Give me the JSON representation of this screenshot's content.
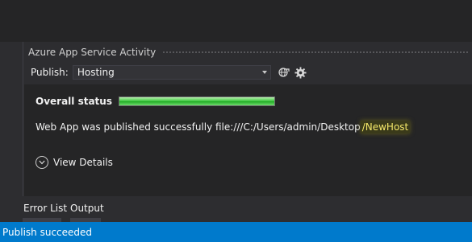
{
  "panel": {
    "title": "Azure App Service Activity",
    "publish_label": "Publish:",
    "profile_value": "Hosting"
  },
  "status": {
    "label": "Overall status",
    "progress": 1.0,
    "progress_color": "#39c63a"
  },
  "message": {
    "prefix": "Web App was published successfully file:///C:/Users/admin/Desktop",
    "highlight": "/NewHost"
  },
  "details": {
    "label": "View Details"
  },
  "tabs": [
    {
      "label": "Error List"
    },
    {
      "label": "Output"
    }
  ],
  "statusbar": {
    "text": "Publish succeeded",
    "color": "#007acc"
  },
  "icons": {
    "globe": "globe-icon",
    "settings": "gear-icon",
    "dropdown": "chevron-down-icon",
    "expand": "chevron-down-circle-icon"
  }
}
